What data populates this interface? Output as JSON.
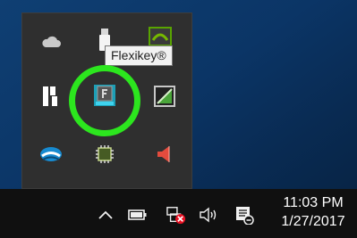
{
  "tooltip": {
    "text": "Flexikey®"
  },
  "tray_flyout": {
    "icons": [
      "onedrive-cloud-icon",
      "usb-drive-icon",
      "nvidia-icon",
      "hotkey-app-icon",
      "flexikey-icon",
      "graphics-panel-icon",
      "bluetooth-icon",
      "processor-chip-icon",
      "audio-speaker-icon"
    ]
  },
  "taskbar": {
    "icons": [
      "show-hidden-icons-chevron-icon",
      "battery-icon",
      "network-disconnected-icon",
      "volume-icon",
      "action-center-icon"
    ],
    "time": "11:03 PM",
    "date": "1/27/2017"
  },
  "colors": {
    "highlight_ring": "#2ce61e",
    "desktop": "#0b3566",
    "taskbar": "#101010",
    "flyout": "#2f2f2f"
  }
}
